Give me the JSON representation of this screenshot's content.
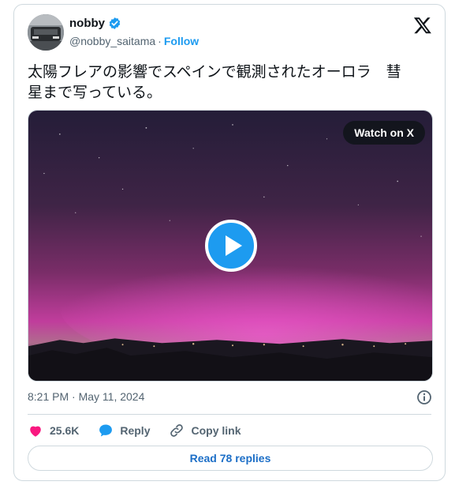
{
  "author": {
    "name": "nobby",
    "handle": "@nobby_saitama",
    "separator": "·",
    "follow_label": "Follow"
  },
  "tweet": {
    "text": "太陽フレアの影響でスペインで観測されたオーロラ　彗\n星まで写っている。"
  },
  "media": {
    "watch_label": "Watch on X"
  },
  "meta": {
    "timestamp": "8:21 PM · May 11, 2024"
  },
  "actions": {
    "like_count": "25.6K",
    "reply_label": "Reply",
    "copy_label": "Copy link"
  },
  "read_replies": "Read 78 replies",
  "icons": {
    "verified": "verified-badge-icon",
    "x_logo": "x-logo-icon",
    "play": "play-icon",
    "info": "info-icon",
    "heart": "heart-icon",
    "reply": "reply-bubble-icon",
    "link": "link-icon"
  },
  "colors": {
    "accent": "#1d9bf0",
    "like": "#f91880",
    "link_text": "#1d6fc7",
    "muted": "#536471",
    "border": "#cfd9de"
  }
}
